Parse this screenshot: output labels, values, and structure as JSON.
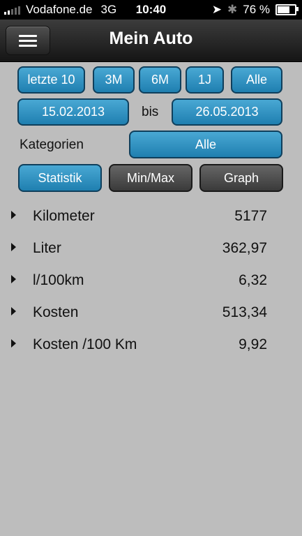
{
  "status": {
    "carrier": "Vodafone.de",
    "network": "3G",
    "time": "10:40",
    "battery": "76 %"
  },
  "nav": {
    "title": "Mein Auto"
  },
  "range_buttons": [
    {
      "label": "letzte 10"
    },
    {
      "label": "3M"
    },
    {
      "label": "6M"
    },
    {
      "label": "1J"
    },
    {
      "label": "Alle"
    }
  ],
  "dates": {
    "from": "15.02.2013",
    "separator": "bis",
    "to": "26.05.2013"
  },
  "category": {
    "label": "Kategorien",
    "value": "Alle"
  },
  "views": {
    "statistik": "Statistik",
    "minmax": "Min/Max",
    "graph": "Graph"
  },
  "stats": [
    {
      "name": "Kilometer",
      "value": "5177"
    },
    {
      "name": "Liter",
      "value": "362,97"
    },
    {
      "name": "l/100km",
      "value": "6,32"
    },
    {
      "name": "Kosten",
      "value": "513,34"
    },
    {
      "name": "Kosten /100 Km",
      "value": "9,92"
    }
  ]
}
